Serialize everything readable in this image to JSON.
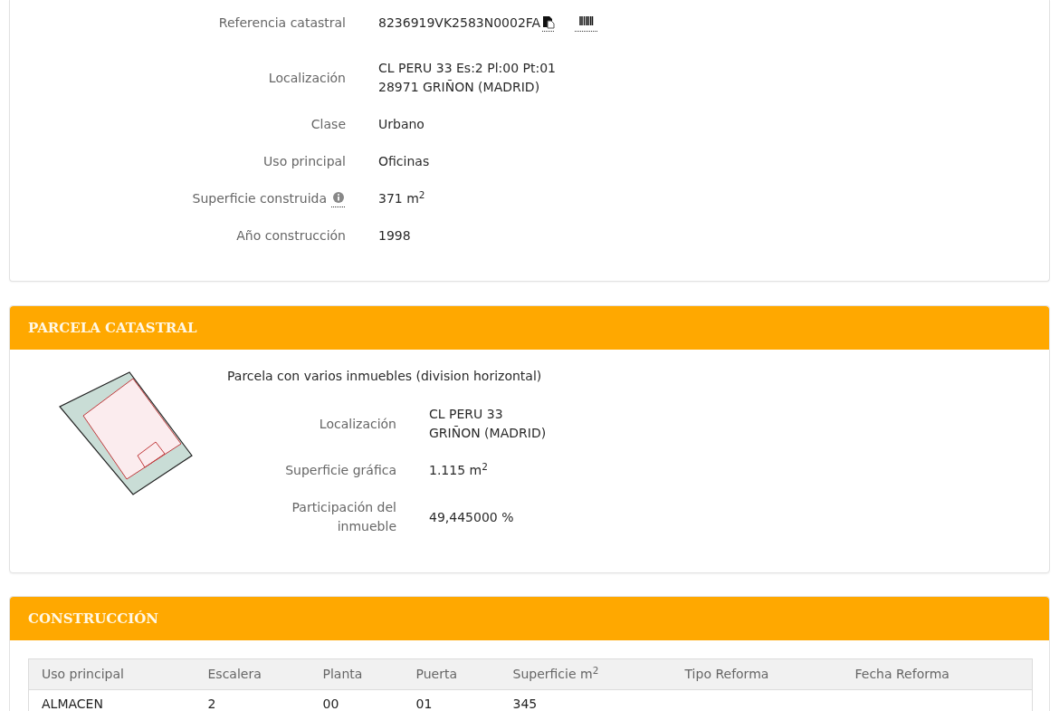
{
  "inmueble": {
    "fields": [
      {
        "kind": "reference",
        "label": "Referencia catastral",
        "lines": [
          "8236919VK2583N0002FA"
        ]
      },
      {
        "kind": "plain",
        "label": "Localización",
        "lines": [
          "CL PERU 33 Es:2 Pl:00 Pt:01",
          "28971 GRIÑON (MADRID)"
        ]
      },
      {
        "kind": "plain",
        "label": "Clase",
        "lines": [
          "Urbano"
        ]
      },
      {
        "kind": "plain",
        "label": "Uso principal",
        "lines": [
          "Oficinas"
        ]
      },
      {
        "kind": "info",
        "label": "Superficie construida",
        "lines": [
          "371 m$^{2}$"
        ]
      },
      {
        "kind": "plain",
        "label": "Año construcción",
        "lines": [
          "1998"
        ]
      }
    ]
  },
  "parcela": {
    "title": "PARCELA CATASTRAL",
    "description": "Parcela con varios inmuebles (division horizontal)",
    "fields": [
      {
        "label": "Localización",
        "lines": [
          "CL PERU 33",
          "GRIÑON (MADRID)"
        ]
      },
      {
        "label": "Superficie gráfica",
        "lines": [
          "1.115 m$^{2}$"
        ]
      },
      {
        "label": "Participación del inmueble",
        "lines": [
          "49,445000 %"
        ]
      }
    ]
  },
  "construccion": {
    "title": "CONSTRUCCIÓN",
    "table": {
      "columns": [
        "Uso principal",
        "Escalera",
        "Planta",
        "Puerta",
        "Superficie m$^{2}$",
        "Tipo Reforma",
        "Fecha Reforma"
      ],
      "rows": [
        [
          "ALMACEN",
          "2",
          "00",
          "01",
          "345"
        ]
      ]
    }
  }
}
